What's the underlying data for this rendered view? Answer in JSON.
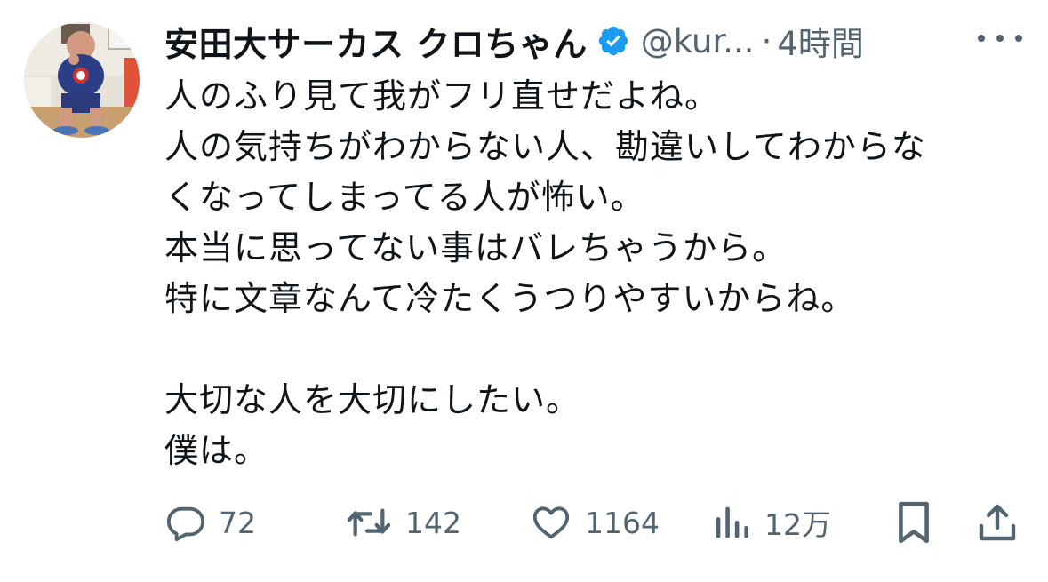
{
  "user": {
    "display_name": "安田大サーカス クロちゃん",
    "handle": "@kur...",
    "separator": "·",
    "time_ago": "4時間",
    "verified": true,
    "verified_color": "#1d9bf0"
  },
  "tweet": {
    "lines": [
      "人のふり見て我がフリ直せだよね。",
      "人の気持ちがわからない人、勘違いしてわからな",
      "くなってしまってる人が怖い。",
      "本当に思ってない事はバレちゃうから。",
      "特に文章なんて冷たくうつりやすいからね。",
      "",
      "大切な人を大切にしたい。",
      "僕は。"
    ]
  },
  "actions": {
    "reply": {
      "icon": "reply-icon",
      "count": "72"
    },
    "retweet": {
      "icon": "retweet-icon",
      "count": "142"
    },
    "like": {
      "icon": "heart-icon",
      "count": "1164"
    },
    "views": {
      "icon": "views-icon",
      "count": "12万"
    },
    "bookmark": {
      "icon": "bookmark-icon"
    },
    "share": {
      "icon": "share-icon"
    }
  },
  "colors": {
    "text": "#0f1419",
    "secondary": "#536471",
    "accent": "#1d9bf0"
  }
}
